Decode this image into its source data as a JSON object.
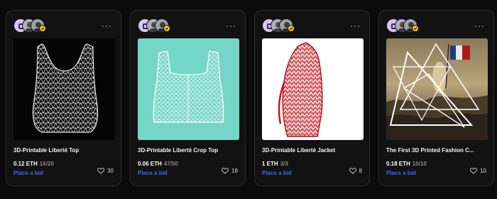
{
  "cards": [
    {
      "title": "3D-Printable Liberté Top",
      "price": "0.12 ETH",
      "edition": "16/20",
      "bid_label": "Place a bid",
      "likes": "30",
      "media_bg": "#050505",
      "media_color": "#e8e8e8"
    },
    {
      "title": "3D-Printable Liberté Crop Top",
      "price": "0.06 ETH",
      "edition": "47/50",
      "bid_label": "Place a bid",
      "likes": "18",
      "media_bg": "#73d6c6",
      "media_color": "#f2f8f7"
    },
    {
      "title": "3D-Printable Liberté Jacket",
      "price": "1 ETH",
      "edition": "3/3",
      "bid_label": "Place a bid",
      "likes": "8",
      "media_bg": "#ffffff",
      "media_color": "#c0161c"
    },
    {
      "title": "The First 3D Printed Fashion C...",
      "price": "0.18 ETH",
      "edition": "10/10",
      "bid_label": "Place a bid",
      "likes": "10",
      "media_bg": "#6e5a3a",
      "media_color": "#ffffff"
    }
  ],
  "more_label": "···",
  "colors": {
    "page_bg": "#0b0b0c",
    "card_bg": "#121213",
    "card_border": "#2c2c2e",
    "bid_link": "#2f6bff",
    "edition_gray": "#8a8a8f",
    "verified_badge": "#f2c230"
  }
}
